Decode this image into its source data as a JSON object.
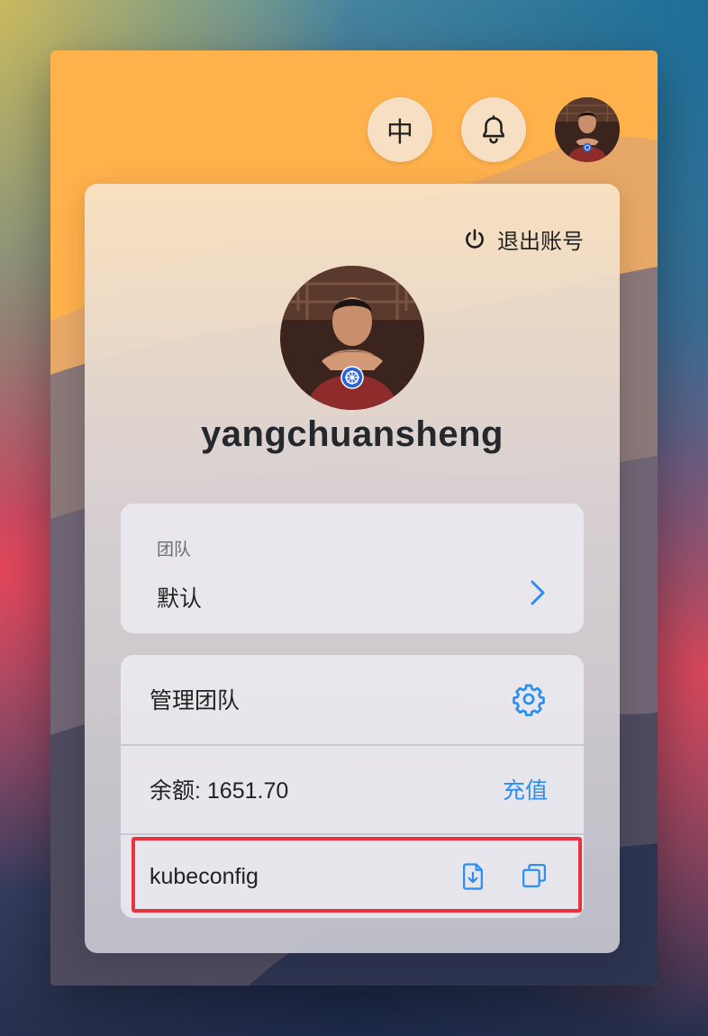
{
  "topbar": {
    "lang_label": "中",
    "notification_icon": "bell-icon",
    "avatar_icon": "user-avatar"
  },
  "panel": {
    "logout_label": "退出账号",
    "username": "yangchuansheng"
  },
  "team": {
    "label": "团队",
    "value": "默认"
  },
  "menu": {
    "manage_team_label": "管理团队",
    "balance_label": "余额: 1651.70",
    "recharge_label": "充值",
    "kubeconfig_label": "kubeconfig"
  },
  "colors": {
    "accent": "#2a8ef1",
    "highlight": "#e8323c",
    "window_top": "#ffb14c"
  }
}
